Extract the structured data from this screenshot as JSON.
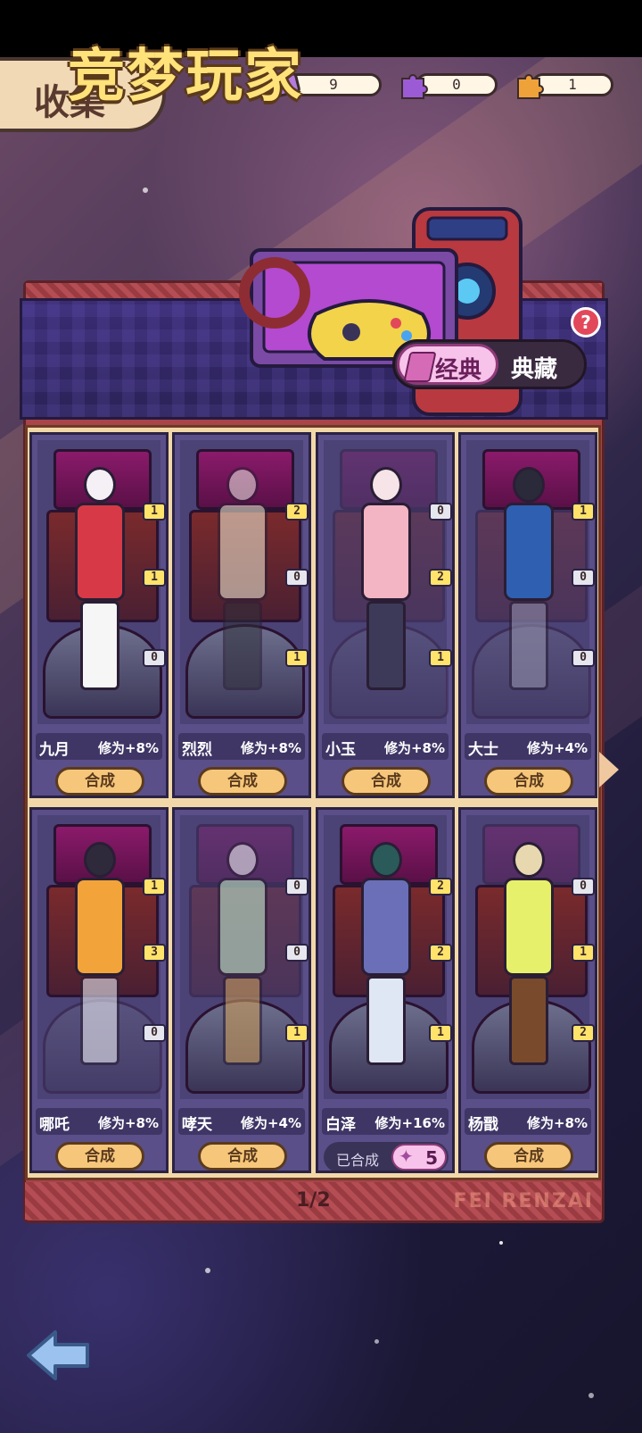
{
  "header": {
    "title": "收集"
  },
  "currencies": [
    {
      "icon": "ticket-icon",
      "value": "9"
    },
    {
      "icon": "purple-puzzle-icon",
      "value": "0"
    },
    {
      "icon": "orange-puzzle-icon",
      "value": "1"
    }
  ],
  "banner": {
    "title": "竞梦玩家",
    "tabs": [
      {
        "label": "经典",
        "active": true
      },
      {
        "label": "典藏",
        "active": false
      }
    ],
    "help": "?"
  },
  "cards": [
    {
      "name": "九月",
      "bonus": "修为+8%",
      "badges": [
        "1",
        "1",
        "0"
      ],
      "action": "合成",
      "collected": false
    },
    {
      "name": "烈烈",
      "bonus": "修为+8%",
      "badges": [
        "2",
        "0",
        "1"
      ],
      "action": "合成",
      "collected": false
    },
    {
      "name": "小玉",
      "bonus": "修为+8%",
      "badges": [
        "0",
        "2",
        "1"
      ],
      "action": "合成",
      "collected": false
    },
    {
      "name": "大士",
      "bonus": "修为+4%",
      "badges": [
        "1",
        "0",
        "0"
      ],
      "action": "合成",
      "collected": false
    },
    {
      "name": "哪吒",
      "bonus": "修为+8%",
      "badges": [
        "1",
        "3",
        "0"
      ],
      "action": "合成",
      "collected": false
    },
    {
      "name": "哮天",
      "bonus": "修为+4%",
      "badges": [
        "0",
        "0",
        "1"
      ],
      "action": "合成",
      "collected": false
    },
    {
      "name": "白泽",
      "bonus": "修为+16%",
      "badges": [
        "2",
        "2",
        "1"
      ],
      "action": "已合成",
      "collected": true,
      "count": "5"
    },
    {
      "name": "杨戬",
      "bonus": "修为+8%",
      "badges": [
        "0",
        "1",
        "2"
      ],
      "action": "合成",
      "collected": false
    }
  ],
  "pagination": {
    "page": "1/2",
    "watermark": "FEI RENZAI"
  },
  "colors": {
    "accent_yellow": "#ffe27a",
    "button_fill": "#f6c77a",
    "panel_red": "#a8444a",
    "card_purple": "#5a4f88",
    "toggle_pink": "#f7c3ea"
  }
}
